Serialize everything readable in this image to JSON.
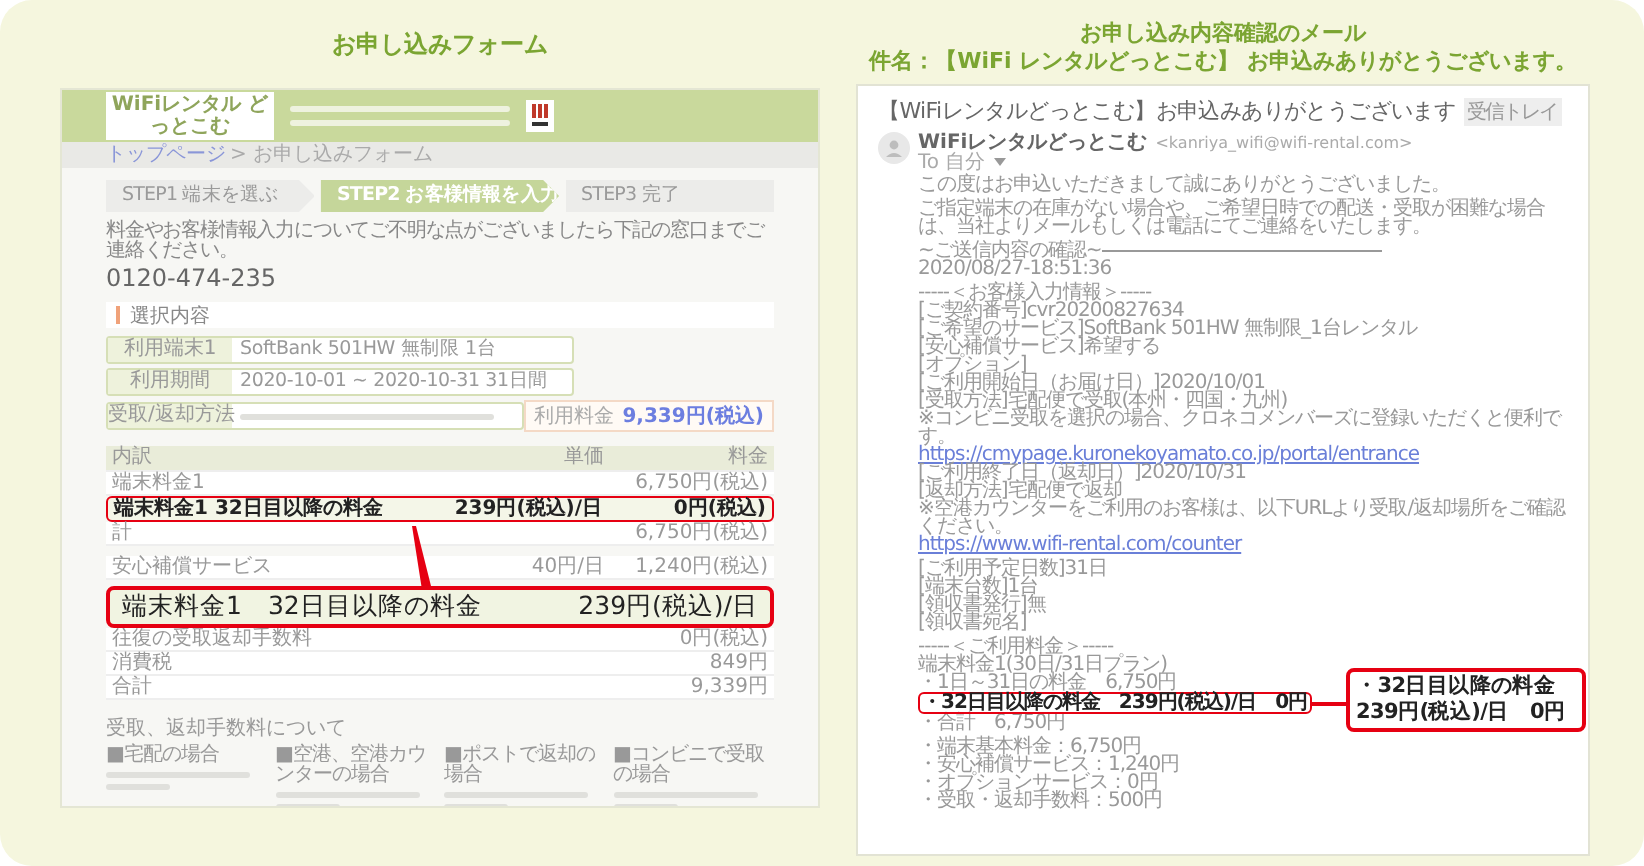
{
  "form": {
    "heading": "お申し込みフォーム",
    "site_logo": "WiFiレンタル どっとこむ",
    "breadcrumb": {
      "link": "トップページ",
      "current": "> お申し込みフォーム"
    },
    "steps": [
      {
        "label": "STEP1 端末を選ぶ",
        "selected": false
      },
      {
        "label": "STEP2 お客様情報を入力",
        "selected": true
      },
      {
        "label": "STEP3 完了",
        "selected": false
      }
    ],
    "contact_note": "料金やお客様情報入力についてご不明な点がございましたら下記の窓口までご連絡ください。",
    "phone": "0120-474-235",
    "section_title": "選択内容",
    "details": [
      {
        "label": "利用端末1",
        "value": "SoftBank 501HW 無制限 1台"
      },
      {
        "label": "利用期間",
        "value": "2020-10-01 ~ 2020-10-31 31日間"
      },
      {
        "label": "受取/返却方法"
      }
    ],
    "total_box": {
      "label": "利用料金",
      "value": "9,339円(税込)"
    },
    "table": {
      "columns": [
        "内訳",
        "単価",
        "料金"
      ],
      "rows": [
        {
          "item": "端末料金1",
          "price": "6,750円(税込)",
          "highlighted": false
        },
        {
          "item": "端末料金1 32日目以降の料金",
          "unit_price": "239円(税込)/日",
          "price": "0円(税込)",
          "highlighted": true
        },
        {
          "item": "計",
          "price": "6,750円(税込)",
          "highlighted": false
        },
        {
          "item": "安心補償サービス",
          "unit_price": "40円/日",
          "price": "1,240円(税込)",
          "highlighted": false
        },
        {
          "item": "往復の受取返却手数料",
          "price": "0円(税込)",
          "highlighted": false
        },
        {
          "item": "消費税",
          "price": "849円",
          "highlighted": false
        },
        {
          "item": "合計",
          "price": "9,339円",
          "highlighted": false
        }
      ]
    },
    "callout": {
      "item": "端末料金1　32日目以降の料金",
      "unit_price": "239円(税込)/日"
    },
    "notes_title": "受取、返却手数料について",
    "notes": [
      "■宅配の場合",
      "■空港、空港カウンターの場合",
      "■ポストで返却の場合",
      "■コンビニで受取の場合"
    ]
  },
  "email": {
    "heading": [
      "お申し込み内容確認のメール",
      "件名：【WiFi レンタルどっとこむ】 お申込みありがとうございます。"
    ],
    "subject": "【WiFiレンタルどっとこむ】お申込みありがとうございます",
    "label_badge": "受信トレイ",
    "sender": "WiFiレンタルどっとこむ",
    "sender_address": "<kanriya_wifi@wifi-rental.com>",
    "to": "To 自分",
    "callout": "・32日目以降の料金　239円(税込)/日　0円",
    "body": [
      [
        {
          "text": "この度はお申込いただきまして誠にありがとうございました。",
          "kind": "text"
        }
      ],
      [
        {
          "text": "ご指定端末の在庫がない場合や、ご希望日時での配送・受取が困難な場合は、当社よりメールもしくは電話にてご連絡をいたします。",
          "kind": "text"
        }
      ],
      [
        {
          "text": "~ご送信内容の確認~",
          "kind": "rule"
        },
        {
          "text": "2020/08/27-18:51:36",
          "kind": "text"
        }
      ],
      [
        {
          "text": "-----＜お客様入力情報＞-----",
          "kind": "text"
        },
        {
          "text": "[ご契約番号]cvr20200827634",
          "kind": "text"
        },
        {
          "text": "[ご希望のサービス]SoftBank 501HW 無制限_1台レンタル",
          "kind": "text"
        },
        {
          "text": "[安心補償サービス]希望する",
          "kind": "text"
        },
        {
          "text": "[オプション]",
          "kind": "text"
        },
        {
          "text": "[ご利用開始日（お届け日）]2020/10/01",
          "kind": "text"
        },
        {
          "text": "[受取方法]宅配便で受取(本州・四国・九州)",
          "kind": "text"
        },
        {
          "text": "※コンビニ受取を選択の場合、クロネコメンバーズに登録いただくと便利です。",
          "kind": "text"
        },
        {
          "text": "https://cmypage.kuronekoyamato.co.jp/portal/entrance",
          "kind": "link"
        },
        {
          "text": "[ご利用終了日（返却日）]2020/10/31",
          "kind": "text"
        },
        {
          "text": "[返却方法]宅配便で返却",
          "kind": "text"
        },
        {
          "text": "※空港カウンターをご利用のお客様は、以下URLより受取/返却場所をご確認ください。",
          "kind": "text"
        },
        {
          "text": "https://www.wifi-rental.com/counter",
          "kind": "link"
        }
      ],
      [
        {
          "text": "[ご利用予定日数]31日",
          "kind": "text"
        },
        {
          "text": "[端末台数]1台",
          "kind": "text"
        },
        {
          "text": "[領収書発行]無",
          "kind": "text"
        },
        {
          "text": "[領収書宛名]",
          "kind": "text"
        }
      ],
      [
        {
          "text": "-----＜ご利用料金＞-----",
          "kind": "text"
        },
        {
          "text": "端末料金1(30日/31日プラン)",
          "kind": "text"
        },
        {
          "text": "・1日～31日の料金　6,750円",
          "kind": "text"
        },
        {
          "text": "・32日目以降の料金　239円(税込)/日　0円",
          "kind": "marked"
        },
        {
          "text": "・合計　6,750円",
          "kind": "text"
        }
      ],
      [
        {
          "text": "・端末基本料金：6,750円",
          "kind": "text"
        },
        {
          "text": "・安心補償サービス：1,240円",
          "kind": "text"
        },
        {
          "text": "・オプションサービス：0円",
          "kind": "text"
        },
        {
          "text": "・受取・返却手数料：500円",
          "kind": "text"
        }
      ]
    ]
  }
}
